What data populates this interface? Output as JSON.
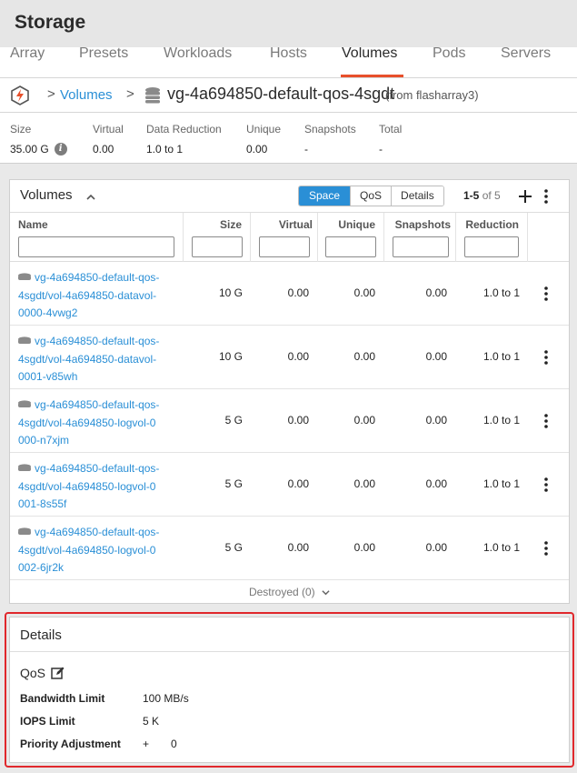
{
  "app": {
    "title": "Storage"
  },
  "tabs": [
    {
      "label": "Array"
    },
    {
      "label": "Presets"
    },
    {
      "label": "Workloads"
    },
    {
      "label": "Hosts"
    },
    {
      "label": "Volumes",
      "active": true
    },
    {
      "label": "Pods"
    },
    {
      "label": "Servers"
    }
  ],
  "breadcrumb": {
    "parent": "Volumes",
    "separator": ">",
    "current": "vg-4a694850-default-qos-4sgdt",
    "source": "(from flasharray3)"
  },
  "summary": {
    "size_label": "Size",
    "size_value": "35.00 G",
    "virtual_label": "Virtual",
    "virtual_value": "0.00",
    "reduction_label": "Data Reduction",
    "reduction_value": "1.0 to 1",
    "unique_label": "Unique",
    "unique_value": "0.00",
    "snapshots_label": "Snapshots",
    "snapshots_value": "-",
    "total_label": "Total",
    "total_value": "-"
  },
  "volumes_panel": {
    "title": "Volumes",
    "views": [
      "Space",
      "QoS",
      "Details"
    ],
    "active_view": "Space",
    "pager_range": "1-5",
    "pager_of": "of 5",
    "columns": [
      "Name",
      "Size",
      "Virtual",
      "Unique",
      "Snapshots",
      "Reduction"
    ],
    "rows": [
      {
        "name": "vg-4a694850-default-qos-4sgdt/vol-4a694850-datavol-0000-4vwg2",
        "name_lines": [
          "vg-4a694850-default-qos-",
          "4sgdt/vol-4a694850-datavol-",
          "0000-4vwg2"
        ],
        "size": "10 G",
        "virtual": "0.00",
        "unique": "0.00",
        "snapshots": "0.00",
        "reduction": "1.0 to 1"
      },
      {
        "name": "vg-4a694850-default-qos-4sgdt/vol-4a694850-datavol-0001-v85wh",
        "name_lines": [
          "vg-4a694850-default-qos-",
          "4sgdt/vol-4a694850-datavol-",
          "0001-v85wh"
        ],
        "size": "10 G",
        "virtual": "0.00",
        "unique": "0.00",
        "snapshots": "0.00",
        "reduction": "1.0 to 1"
      },
      {
        "name": "vg-4a694850-default-qos-4sgdt/vol-4a694850-logvol-0000-n7xjm",
        "name_lines": [
          "vg-4a694850-default-qos-",
          "4sgdt/vol-4a694850-logvol-0",
          "000-n7xjm"
        ],
        "size": "5 G",
        "virtual": "0.00",
        "unique": "0.00",
        "snapshots": "0.00",
        "reduction": "1.0 to 1"
      },
      {
        "name": "vg-4a694850-default-qos-4sgdt/vol-4a694850-logvol-0001-8s55f",
        "name_lines": [
          "vg-4a694850-default-qos-",
          "4sgdt/vol-4a694850-logvol-0",
          "001-8s55f"
        ],
        "size": "5 G",
        "virtual": "0.00",
        "unique": "0.00",
        "snapshots": "0.00",
        "reduction": "1.0 to 1"
      },
      {
        "name": "vg-4a694850-default-qos-4sgdt/vol-4a694850-logvol-0002-6jr2k",
        "name_lines": [
          "vg-4a694850-default-qos-",
          "4sgdt/vol-4a694850-logvol-0",
          "002-6jr2k"
        ],
        "size": "5 G",
        "virtual": "0.00",
        "unique": "0.00",
        "snapshots": "0.00",
        "reduction": "1.0 to 1"
      }
    ],
    "destroyed_label": "Destroyed (0)"
  },
  "details": {
    "title": "Details",
    "qos_label": "QoS",
    "bandwidth_label": "Bandwidth Limit",
    "bandwidth_value": "100 MB/s",
    "iops_label": "IOPS Limit",
    "iops_value": "5 K",
    "priority_label": "Priority Adjustment",
    "priority_sign": "+",
    "priority_value": "0"
  },
  "colors": {
    "accent": "#2a8fd6",
    "tab_underline": "#e8502b",
    "highlight_outline": "#e0282c"
  },
  "icons": [
    "flash-logo-icon",
    "volume-group-icon",
    "info-icon",
    "chevron-up-icon",
    "plus-icon",
    "kebab-icon",
    "volume-icon",
    "chevron-down-icon",
    "edit-icon"
  ]
}
